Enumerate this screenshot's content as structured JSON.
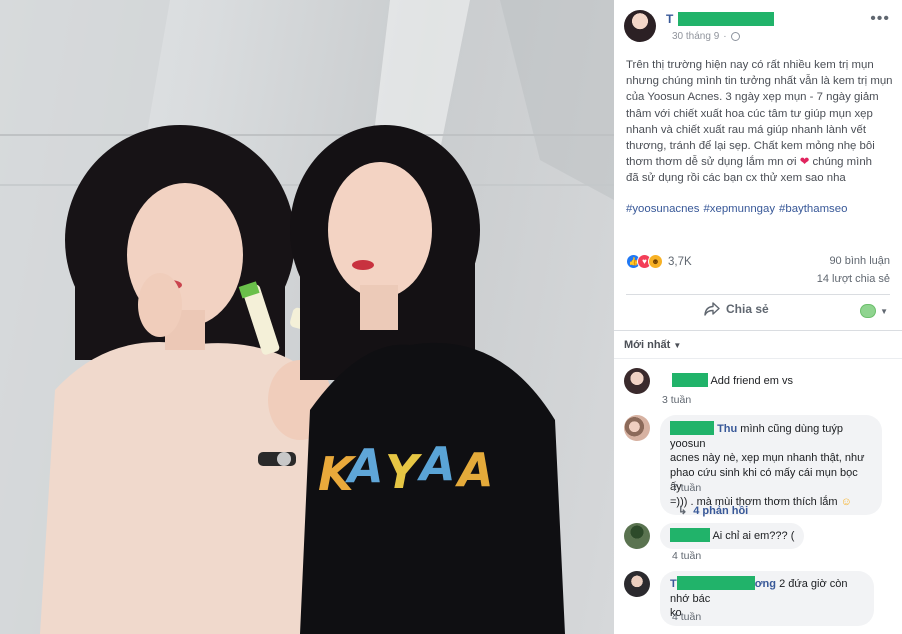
{
  "post": {
    "author_initial": "T",
    "date": "30 tháng 9",
    "dot": "·",
    "text": "Trên thị trường hiện nay có rất nhiều kem trị mụn\nnhưng chúng mình tin tưởng nhất vẫn là kem trị mụn\ncủa Yoosun Acnes. 3 ngày xẹp mụn - 7 ngày giảm\nthâm với chiết xuất hoa cúc tâm tư giúp mụn xẹp\nnhanh và chiết xuất rau má giúp nhanh lành vết\nthương, tránh để lại sẹp. Chất kem mỏng nhẹ bôi\nthơm thơm dễ sử dụng lắm mn ơi",
    "text_after_heart": "chúng mình",
    "text_end": "đã sử dụng rồi các bạn cx thử xem sao nha",
    "hashtags": [
      "#yoosunacnes",
      "#xepmunngay",
      "#baythamseo"
    ]
  },
  "stats": {
    "reaction_count": "3,7K",
    "comments": "90 bình luận",
    "shares": "14 lượt chia sẻ"
  },
  "actions": {
    "share_label": "Chia sẻ"
  },
  "comments": {
    "sort_label": "Mới nhất",
    "items": [
      {
        "name_prefix": "",
        "name_suffix": "",
        "text": "Add friend em vs",
        "time": "3 tuần",
        "mask_width": 36
      },
      {
        "name_prefix": "",
        "name_suffix": "Thu",
        "text": "mình cũng dùng tuýp yoosun\nacnes này nè, xẹp mụn nhanh thật, như\nphao cứu sinh khi có mấy cái mụn bọc ấy\n=))) . mà mùi thơm thơm thích lắm",
        "time": "7 tuần",
        "mask_width": 44,
        "replies": "4 phản hồi"
      },
      {
        "name_prefix": "",
        "name_suffix": "",
        "text": "Ai chỉ ai em??? (",
        "time": "4 tuần",
        "mask_width": 40
      },
      {
        "name_prefix": "T",
        "name_suffix": "ơng",
        "text": "2 đứa giờ còn nhớ bác\nko",
        "time": "4 tuần",
        "mask_width": 80
      }
    ]
  },
  "colors": {
    "link": "#385898",
    "mask": "#21b36a",
    "love": "#f33e58",
    "like": "#2078f4"
  }
}
